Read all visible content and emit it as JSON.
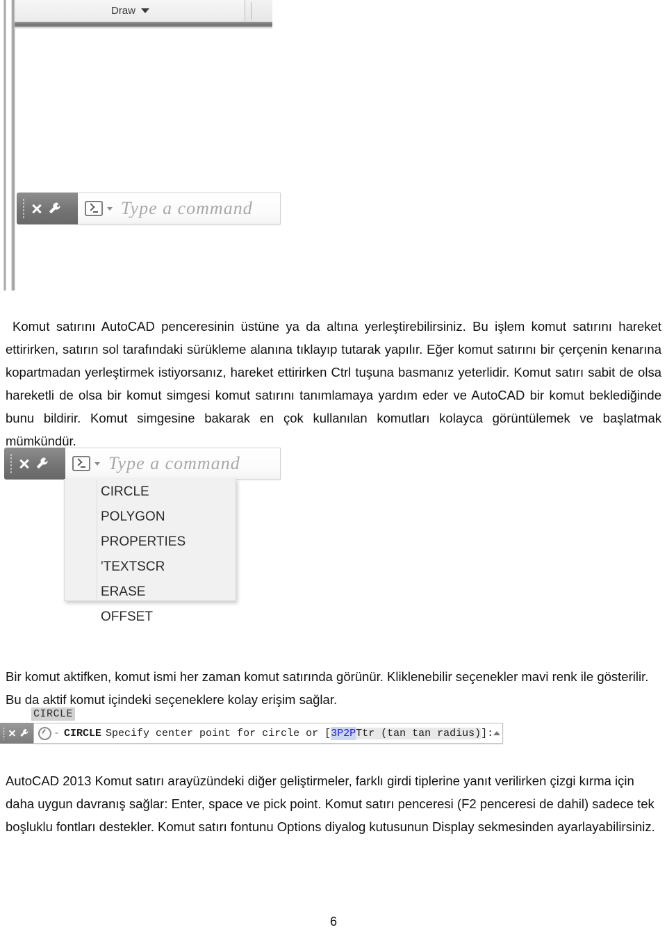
{
  "document": {
    "page_number": "6"
  },
  "figure_ribbon": {
    "tab_label": "Draw",
    "caret_icon": "chevron-down-icon"
  },
  "figure_commandline_plain": {
    "close_icon": "close-icon",
    "settings_icon": "wrench-icon",
    "prompt_icon": "command-prompt-icon",
    "dropdown_caret_icon": "chevron-down-icon",
    "placeholder": "Type a command"
  },
  "figure_commandline_suggestions": {
    "close_icon": "close-icon",
    "settings_icon": "wrench-icon",
    "prompt_icon": "command-prompt-icon",
    "dropdown_caret_icon": "chevron-down-icon",
    "placeholder": "Type a command",
    "suggestions": [
      "CIRCLE",
      "POLYGON",
      "PROPERTIES",
      "'TEXTSCR",
      "ERASE",
      "OFFSET"
    ]
  },
  "figure_circle_command": {
    "tooltip": "CIRCLE",
    "close_icon": "close-icon",
    "settings_icon": "wrench-icon",
    "command_icon": "circle-command-icon",
    "separator": "-",
    "command_name": "CIRCLE",
    "prompt_before": "Specify center point for circle or [",
    "option_3p": "3P",
    "option_gap1": " ",
    "option_2p": "2P",
    "option_gap2": " ",
    "option_ttr": "Ttr (tan tan radius)",
    "prompt_after": "]:",
    "expand_icon": "chevron-up-icon",
    "option_color": "#2020c8",
    "option_highlight": "#ccd6ef"
  },
  "body": {
    "paragraph_1": "Komut satırını AutoCAD penceresinin üstüne ya da altına yerleştirebilirsiniz. Bu işlem komut satırını hareket ettirirken, satırın sol tarafındaki sürükleme alanına tıklayıp tutarak yapılır. Eğer komut satırını bir çerçenin kenarına kopartmadan yerleştirmek istiyorsanız, hareket ettirirken Ctrl tuşuna basmanız yeterlidir. Komut satırı sabit de olsa hareketli de olsa bir komut simgesi komut satırını tanımlamaya yardım eder ve AutoCAD bir komut beklediğinde bunu bildirir. Komut simgesine bakarak en çok kullanılan komutları kolayca görüntülemek ve başlatmak mümkündür.",
    "paragraph_2": "Bir komut aktifken, komut ismi her zaman komut satırında görünür. Kliklenebilir seçenekler mavi renk ile gösterilir. Bu da aktif komut içindeki seçeneklere kolay erişim sağlar.",
    "paragraph_3": "AutoCAD 2013 Komut satırı arayüzündeki diğer geliştirmeler, farklı girdi tiplerine yanıt verilirken çizgi kırma için daha uygun davranış sağlar: Enter, space ve pick point. Komut satırı penceresi (F2 penceresi de dahil) sadece tek boşluklu fontları destekler. Komut satırı fontunu Options diyalog kutusunun Display sekmesinden ayarlayabilirsiniz."
  }
}
